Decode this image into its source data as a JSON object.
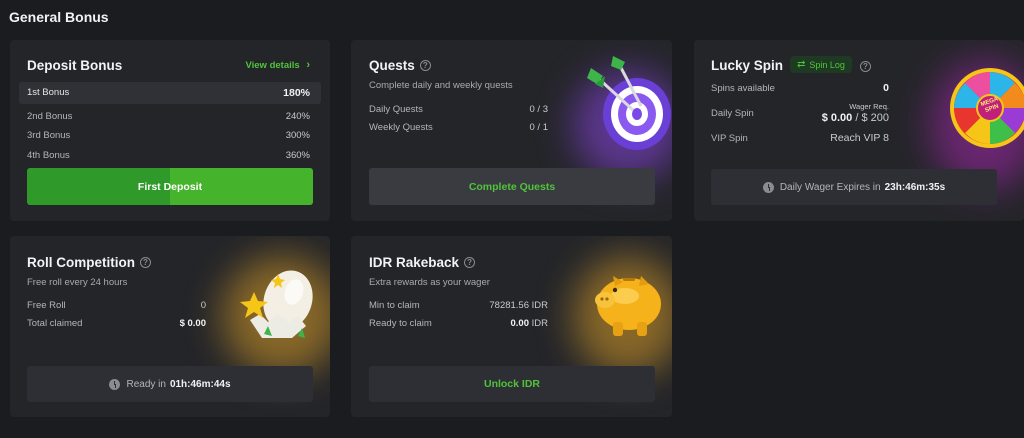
{
  "page_title": "General Bonus",
  "colors": {
    "accent_green": "#4fc43a",
    "card_bg": "#242529",
    "page_bg": "#1b1c1f"
  },
  "deposit_bonus": {
    "title": "Deposit Bonus",
    "view_details": "View details",
    "rows": [
      {
        "label": "1st Bonus",
        "value": "180%"
      },
      {
        "label": "2nd Bonus",
        "value": "240%"
      },
      {
        "label": "3rd Bonus",
        "value": "300%"
      },
      {
        "label": "4th Bonus",
        "value": "360%"
      }
    ],
    "button": "First Deposit"
  },
  "quests": {
    "title": "Quests",
    "subtitle": "Complete daily and weekly quests",
    "rows": [
      {
        "label": "Daily Quests",
        "value": "0 / 3"
      },
      {
        "label": "Weekly Quests",
        "value": "0 / 1"
      }
    ],
    "button": "Complete Quests"
  },
  "lucky_spin": {
    "title": "Lucky Spin",
    "spin_log": "Spin Log",
    "spins_available_label": "Spins available",
    "spins_available_value": "0",
    "daily_spin_label": "Daily Spin",
    "wager_req_label": "Wager Req.",
    "wager_current": "$ 0.00",
    "wager_total": " / $ 200",
    "vip_spin_label": "VIP Spin",
    "vip_spin_value": "Reach VIP 8",
    "expires_label": "Daily Wager Expires in",
    "expires_value": "23h:46m:35s",
    "wheel_text": "MEGA SPIN"
  },
  "roll_competition": {
    "title": "Roll Competition",
    "subtitle": "Free roll every 24 hours",
    "free_roll_label": "Free Roll",
    "free_roll_value": "0",
    "total_claimed_label": "Total claimed",
    "total_claimed_value": "$ 0.00",
    "ready_label": "Ready in",
    "ready_value": "01h:46m:44s"
  },
  "idr_rakeback": {
    "title": "IDR Rakeback",
    "subtitle": "Extra rewards as your wager",
    "min_claim_label": "Min to claim",
    "min_claim_value": "78281.56 IDR",
    "ready_claim_label": "Ready to claim",
    "ready_claim_amount": "0.00",
    "ready_claim_currency": " IDR",
    "button": "Unlock IDR"
  }
}
